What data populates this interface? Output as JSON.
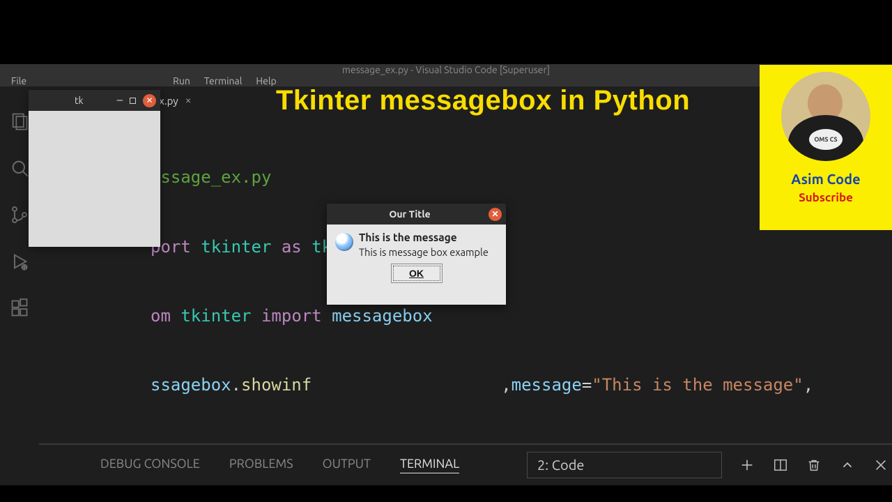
{
  "vscode": {
    "title": "message_ex.py - Visual Studio Code [Superuser]",
    "menu": {
      "file": "File",
      "run": "Run",
      "terminal": "Terminal",
      "help": "Help"
    },
    "tab": {
      "label": "ex.py",
      "close": "×"
    },
    "heading": "Tkinter messagebox in Python",
    "code": {
      "l1_comment": "essage_ex.py",
      "l2_kw1": "port",
      "l2_mod": "tkinter",
      "l2_as": "as",
      "l2_alias": "tk",
      "l3_kw": "om",
      "l3_mod": "tkinter",
      "l3_import": "import",
      "l3_sub": "messagebox",
      "l4_obj": "ssagebox",
      "l4_fn": "showinf",
      "l4_paramname": "message",
      "l4_eq": "=",
      "l4_str": "\"This is the message\"",
      "l4_trailpunc": ","
    },
    "panel": {
      "debug": "DEBUG CONSOLE",
      "problems": "PROBLEMS",
      "output": "OUTPUT",
      "terminal": "TERMINAL",
      "select": "2: Code"
    }
  },
  "tkwin": {
    "title": "tk"
  },
  "msgbox": {
    "title": "Our Title",
    "heading": "This is the message",
    "detail": "This is message box example",
    "ok": "OK"
  },
  "subcard": {
    "name": "Asim Code",
    "subscribe": "Subscribe",
    "shirt": "OMS CS"
  }
}
